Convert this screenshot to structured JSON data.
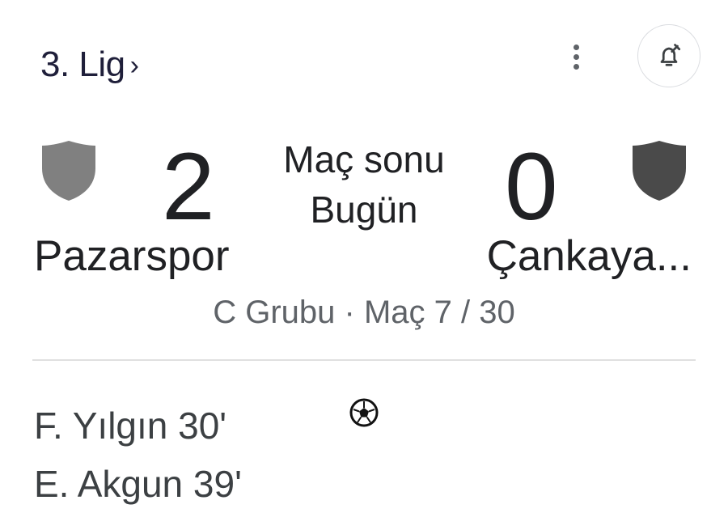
{
  "header": {
    "league_label": "3. Lig",
    "league_chevron": "›"
  },
  "match": {
    "home": {
      "name": "Pazarspor",
      "score": "2"
    },
    "away": {
      "name": "Çankaya...",
      "score": "0"
    },
    "status": "Maç sonu",
    "date": "Bugün",
    "details": "C Grubu · Maç 7 / 30"
  },
  "scorers": [
    {
      "text": "F. Yılgın 30'"
    },
    {
      "text": "E. Akgun 39'"
    }
  ],
  "icons": {
    "more": "more-vert-icon",
    "alert": "notification-add-icon",
    "goal": "soccer-ball-icon"
  },
  "colors": {
    "home_crest": "#808080",
    "away_crest": "#4a4a4a",
    "muted_text": "#5f6368"
  }
}
